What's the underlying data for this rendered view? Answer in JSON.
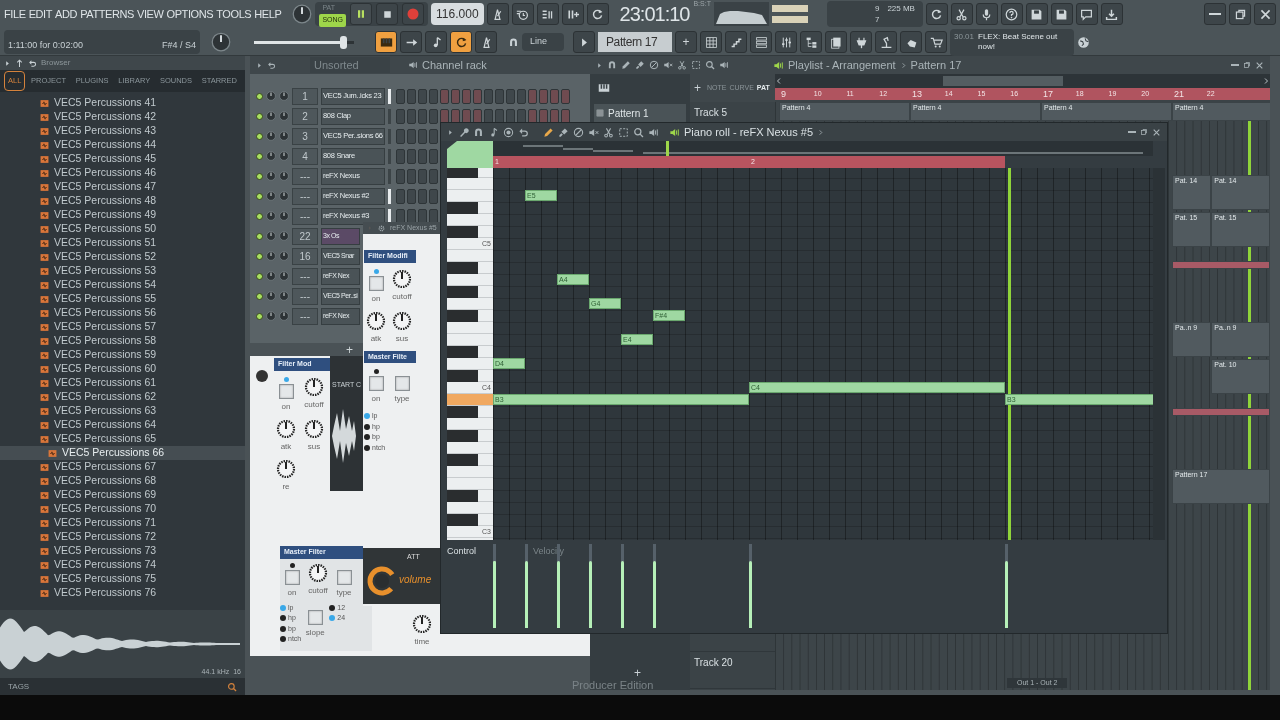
{
  "menu": [
    "FILE",
    "EDIT",
    "ADD",
    "PATTERNS",
    "VIEW",
    "OPTIONS",
    "TOOLS",
    "HELP"
  ],
  "transport": {
    "modes": [
      {
        "label": "PAT",
        "selected": false
      },
      {
        "label": "SONG",
        "selected": true
      }
    ],
    "playing": true,
    "tempo": "116.000",
    "time": "23:01:10",
    "time_format": "B:S:T"
  },
  "monitor": {
    "cpu": "9",
    "memory": "225 MB",
    "polyphony": "7"
  },
  "hint": {
    "text": "1:11:00 for 0:02:00",
    "note": "F#4 / S4"
  },
  "master_volume": {
    "level": 0.9
  },
  "toolbar_toggles": [
    {
      "on": true
    },
    {
      "on": false
    },
    {
      "on": false
    },
    {
      "on": true
    },
    {
      "on": false
    }
  ],
  "snap": "Line",
  "pattern": "Pattern 17",
  "pattern_add": "+",
  "news": {
    "date": "30.01",
    "text": "FLEX: Beat Scene out now!"
  },
  "browser": {
    "title": "Browser",
    "tabs": [
      {
        "label": "ALL",
        "selected": true
      },
      {
        "label": "PROJECT",
        "selected": false
      },
      {
        "label": "PLUGINS",
        "selected": false
      },
      {
        "label": "LIBRARY",
        "selected": false
      },
      {
        "label": "SOUNDS",
        "selected": false
      },
      {
        "label": "STARRED",
        "selected": false
      }
    ],
    "items": [
      {
        "label": "VEC5 Percussions 41",
        "selected": false
      },
      {
        "label": "VEC5 Percussions 42",
        "selected": false
      },
      {
        "label": "VEC5 Percussions 43",
        "selected": false
      },
      {
        "label": "VEC5 Percussions 44",
        "selected": false
      },
      {
        "label": "VEC5 Percussions 45",
        "selected": false
      },
      {
        "label": "VEC5 Percussions 46",
        "selected": false
      },
      {
        "label": "VEC5 Percussions 47",
        "selected": false
      },
      {
        "label": "VEC5 Percussions 48",
        "selected": false
      },
      {
        "label": "VEC5 Percussions 49",
        "selected": false
      },
      {
        "label": "VEC5 Percussions 50",
        "selected": false
      },
      {
        "label": "VEC5 Percussions 51",
        "selected": false
      },
      {
        "label": "VEC5 Percussions 52",
        "selected": false
      },
      {
        "label": "VEC5 Percussions 53",
        "selected": false
      },
      {
        "label": "VEC5 Percussions 54",
        "selected": false
      },
      {
        "label": "VEC5 Percussions 55",
        "selected": false
      },
      {
        "label": "VEC5 Percussions 56",
        "selected": false
      },
      {
        "label": "VEC5 Percussions 57",
        "selected": false
      },
      {
        "label": "VEC5 Percussions 58",
        "selected": false
      },
      {
        "label": "VEC5 Percussions 59",
        "selected": false
      },
      {
        "label": "VEC5 Percussions 60",
        "selected": false
      },
      {
        "label": "VEC5 Percussions 61",
        "selected": false
      },
      {
        "label": "VEC5 Percussions 62",
        "selected": false
      },
      {
        "label": "VEC5 Percussions 63",
        "selected": false
      },
      {
        "label": "VEC5 Percussions 64",
        "selected": false
      },
      {
        "label": "VEC5 Percussions 65",
        "selected": false
      },
      {
        "label": "VEC5 Percussions 66",
        "selected": true
      },
      {
        "label": "VEC5 Percussions 67",
        "selected": false
      },
      {
        "label": "VEC5 Percussions 68",
        "selected": false
      },
      {
        "label": "VEC5 Percussions 69",
        "selected": false
      },
      {
        "label": "VEC5 Percussions 70",
        "selected": false
      },
      {
        "label": "VEC5 Percussions 71",
        "selected": false
      },
      {
        "label": "VEC5 Percussions 72",
        "selected": false
      },
      {
        "label": "VEC5 Percussions 73",
        "selected": false
      },
      {
        "label": "VEC5 Percussions 74",
        "selected": false
      },
      {
        "label": "VEC5 Percussions 75",
        "selected": false
      },
      {
        "label": "VEC5 Percussions 76",
        "selected": false
      }
    ],
    "sample_rate": "44.1 kHz",
    "bit_depth": "16",
    "tags": "TAGS"
  },
  "channel_rack": {
    "filter": "Unsorted",
    "title": "Channel rack",
    "add": "+",
    "channels": [
      {
        "number": "1",
        "name": "VEC5 Jum..icks 23",
        "selected": false,
        "lit": true
      },
      {
        "number": "2",
        "name": "808 Clap",
        "selected": false,
        "lit": false
      },
      {
        "number": "3",
        "name": "VEC5 Per..sions 66",
        "selected": false,
        "lit": false
      },
      {
        "number": "4",
        "name": "808 Snare",
        "selected": false,
        "lit": false
      },
      {
        "number": "---",
        "name": "reFX Nexus",
        "selected": false,
        "lit": false
      },
      {
        "number": "---",
        "name": "reFX Nexus #2",
        "selected": false,
        "lit": true
      },
      {
        "number": "---",
        "name": "reFX Nexus #3",
        "selected": false,
        "lit": true
      },
      {
        "number": "22",
        "name": "3x Os",
        "selected": true
      },
      {
        "number": "16",
        "name": "VEC5 Snar",
        "selected": false
      },
      {
        "number": "---",
        "name": "reFX Nex",
        "selected": false
      },
      {
        "number": "---",
        "name": "VEC5 Per..si",
        "selected": false
      },
      {
        "number": "---",
        "name": "reFX Nex",
        "selected": false
      }
    ]
  },
  "plugin_back": {
    "sampler_label": "START C",
    "controls": [
      {
        "kind": "section",
        "label": "Filter Mod"
      },
      {
        "kind": "button",
        "label": "on",
        "lit": true
      },
      {
        "kind": "knob",
        "label": "cutoff"
      },
      {
        "kind": "knob",
        "label": "atk"
      },
      {
        "kind": "knob",
        "label": "sus"
      },
      {
        "kind": "knob",
        "label": "re"
      },
      {
        "kind": "section",
        "label": "Master Filter"
      },
      {
        "kind": "button",
        "label": "on",
        "lit": false
      },
      {
        "kind": "knob",
        "label": "cutoff"
      },
      {
        "kind": "button",
        "label": "type"
      },
      {
        "kind": "radio",
        "options": [
          {
            "label": "lp",
            "selected": true
          },
          {
            "label": "hp",
            "selected": false
          },
          {
            "label": "bp",
            "selected": false
          },
          {
            "label": "ntch",
            "selected": false
          }
        ]
      },
      {
        "kind": "button",
        "label": "slope"
      },
      {
        "kind": "radio",
        "options": [
          {
            "label": "12",
            "selected": false
          },
          {
            "label": "24",
            "selected": true
          }
        ]
      },
      {
        "kind": "knob",
        "label": "time"
      }
    ]
  },
  "plugin_front": {
    "title": "reFX Nexus #5",
    "strip_label": "ATT",
    "volume_label": "volume",
    "controls": [
      {
        "kind": "section",
        "label": "Filter Modifi"
      },
      {
        "kind": "button",
        "label": "on",
        "lit": true
      },
      {
        "kind": "knob",
        "label": "cutoff"
      },
      {
        "kind": "knob",
        "label": "atk"
      },
      {
        "kind": "knob",
        "label": "sus"
      },
      {
        "kind": "section",
        "label": "Master Filte"
      },
      {
        "kind": "button",
        "label": "on",
        "lit": false
      },
      {
        "kind": "button",
        "label": "type"
      },
      {
        "kind": "radio",
        "options": [
          {
            "label": "lp",
            "selected": true
          },
          {
            "label": "hp",
            "selected": false
          },
          {
            "label": "bp",
            "selected": false
          },
          {
            "label": "ntch",
            "selected": false
          }
        ]
      }
    ]
  },
  "playlist": {
    "title": "Playlist - Arrangement",
    "pattern": "Pattern 17",
    "add_track": "+",
    "add_pattern": "+",
    "output": "Out 1 - Out 2",
    "clip_modes": [
      {
        "label": "NOTE",
        "selected": false
      },
      {
        "label": "CURVE",
        "selected": false
      },
      {
        "label": "PAT",
        "selected": true
      }
    ],
    "picker": [
      "Pattern 1"
    ],
    "ruler": [
      "9",
      "10",
      "11",
      "12",
      "13",
      "14",
      "15",
      "16",
      "17",
      "18",
      "19",
      "20",
      "21",
      "22"
    ],
    "playhead": {
      "level": 0.955
    },
    "tracks": [
      {
        "label": "Track 5"
      },
      {
        "label": "Track 20"
      }
    ],
    "clips": [
      {
        "kind": "pattern",
        "label": "Pattern 4"
      },
      {
        "kind": "pattern",
        "label": "Pattern 4"
      },
      {
        "kind": "pattern",
        "label": "Pattern 4"
      },
      {
        "kind": "pattern",
        "label": "Pattern 4"
      },
      {
        "kind": "pattern",
        "label": "Pat. 14"
      },
      {
        "kind": "pattern",
        "label": "Pat. 14"
      },
      {
        "kind": "pattern",
        "label": "Pat. 15"
      },
      {
        "kind": "pattern",
        "label": "Pat. 15"
      },
      {
        "kind": "automation"
      },
      {
        "kind": "pattern",
        "label": "Pa..n 9"
      },
      {
        "kind": "pattern",
        "label": "Pa..n 9"
      },
      {
        "kind": "pattern",
        "label": "Pat. 10"
      },
      {
        "kind": "automation"
      },
      {
        "kind": "pattern",
        "label": "Pattern 17"
      }
    ]
  },
  "piano_roll": {
    "title": "Piano roll - reFX Nexus #5",
    "ruler": [
      "1",
      "2"
    ],
    "key_labels": [
      "C5",
      "C4",
      "C3"
    ],
    "control_label": "Control",
    "control_target": "Velocity",
    "playhead": {
      "level": 0.78
    },
    "notes": [
      {
        "label": "E5",
        "level": 0.8
      },
      {
        "label": "A4",
        "level": 0.8
      },
      {
        "label": "G4",
        "level": 0.8
      },
      {
        "label": "E4",
        "level": 0.8
      },
      {
        "label": "F#4",
        "level": 0.8
      },
      {
        "label": "D4",
        "level": 0.8
      },
      {
        "label": "B3",
        "level": 0.8,
        "key_pressed": true
      },
      {
        "label": "C4",
        "level": 0.8
      },
      {
        "label": "B3",
        "level": 0.8
      }
    ]
  },
  "edition": "Producer Edition"
}
